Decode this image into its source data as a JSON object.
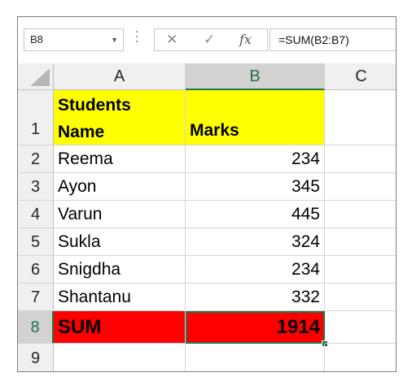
{
  "formula_bar": {
    "name_box": "B8",
    "cancel_icon": "✕",
    "enter_icon": "✓",
    "fx_label": "fx",
    "formula": "=SUM(B2:B7)"
  },
  "columns": [
    "A",
    "B",
    "C"
  ],
  "selected_column": "B",
  "rows": [
    {
      "num": "1",
      "a_line1": "Students",
      "a_line2": "Name",
      "b": "Marks"
    },
    {
      "num": "2",
      "a": "Reema",
      "b": "234"
    },
    {
      "num": "3",
      "a": "Ayon",
      "b": "345"
    },
    {
      "num": "4",
      "a": "Varun",
      "b": "445"
    },
    {
      "num": "5",
      "a": "Sukla",
      "b": "324"
    },
    {
      "num": "6",
      "a": "Snigdha",
      "b": "234"
    },
    {
      "num": "7",
      "a": "Shantanu",
      "b": "332"
    },
    {
      "num": "8",
      "a": "SUM",
      "b": "1914"
    },
    {
      "num": "9",
      "a": "",
      "b": ""
    }
  ],
  "colors": {
    "header_fill": "#ffff00",
    "sum_fill": "#ff0000",
    "selection": "#217346"
  }
}
